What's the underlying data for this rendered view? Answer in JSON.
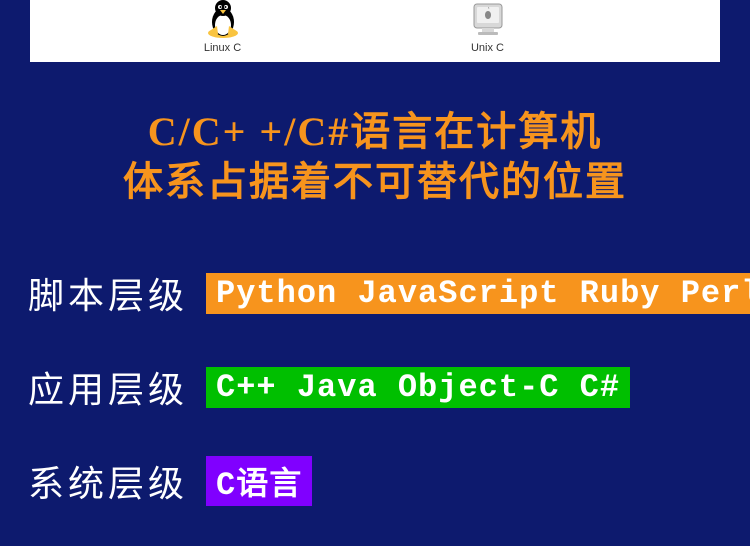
{
  "top": {
    "linux_label": "Linux C",
    "unix_label": "Unix C"
  },
  "heading": {
    "line1": "C/C+ +/C#语言在计算机",
    "line2": "体系占据着不可替代的位置"
  },
  "layers": {
    "script": {
      "label": "脚本层级",
      "value": "Python JavaScript Ruby Perl"
    },
    "app": {
      "label": "应用层级",
      "value": "C++ Java Object-C C#"
    },
    "system": {
      "label": "系统层级",
      "value": "C语言"
    }
  }
}
